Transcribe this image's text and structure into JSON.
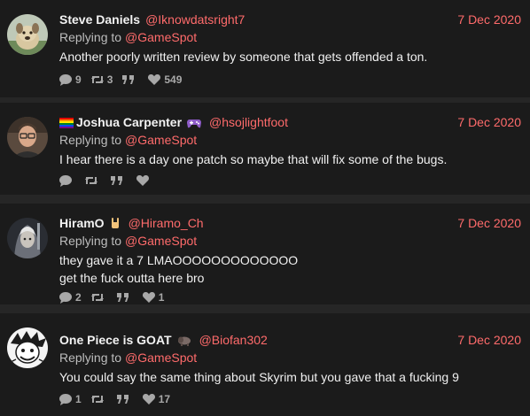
{
  "colors": {
    "accent": "#ff6b6b",
    "background": "#262626",
    "card": "#1b1b1b"
  },
  "tweets": [
    {
      "name": "Steve Daniels",
      "handle": "@Iknowdatsright7",
      "date": "7 Dec 2020",
      "replying_prefix": "Replying to",
      "replying_to": "@GameSpot",
      "lines": [
        "Another poorly written review by someone that gets offended a ton."
      ],
      "replies": "9",
      "retweets": "3",
      "quotes": "",
      "likes": "549"
    },
    {
      "name": "Joshua Carpenter",
      "handle": "@hsojlightfoot",
      "date": "7 Dec 2020",
      "replying_prefix": "Replying to",
      "replying_to": "@GameSpot",
      "lines": [
        "I hear there is a day one patch so maybe that will fix some of the bugs."
      ],
      "replies": "",
      "retweets": "",
      "quotes": "",
      "likes": ""
    },
    {
      "name": "HiramO",
      "handle": "@Hiramo_Ch",
      "date": "7 Dec 2020",
      "replying_prefix": "Replying to",
      "replying_to": "@GameSpot",
      "lines": [
        "they gave it a 7 LMAOOOOOOOOOOOOO",
        "get the fuck outta here bro"
      ],
      "replies": "2",
      "retweets": "",
      "quotes": "",
      "likes": "1"
    },
    {
      "name": "One Piece is GOAT",
      "handle": "@Biofan302",
      "date": "7 Dec 2020",
      "replying_prefix": "Replying to",
      "replying_to": "@GameSpot",
      "lines": [
        "You could say the same thing about Skyrim but you gave that a fucking 9"
      ],
      "replies": "1",
      "retweets": "",
      "quotes": "",
      "likes": "17"
    }
  ]
}
